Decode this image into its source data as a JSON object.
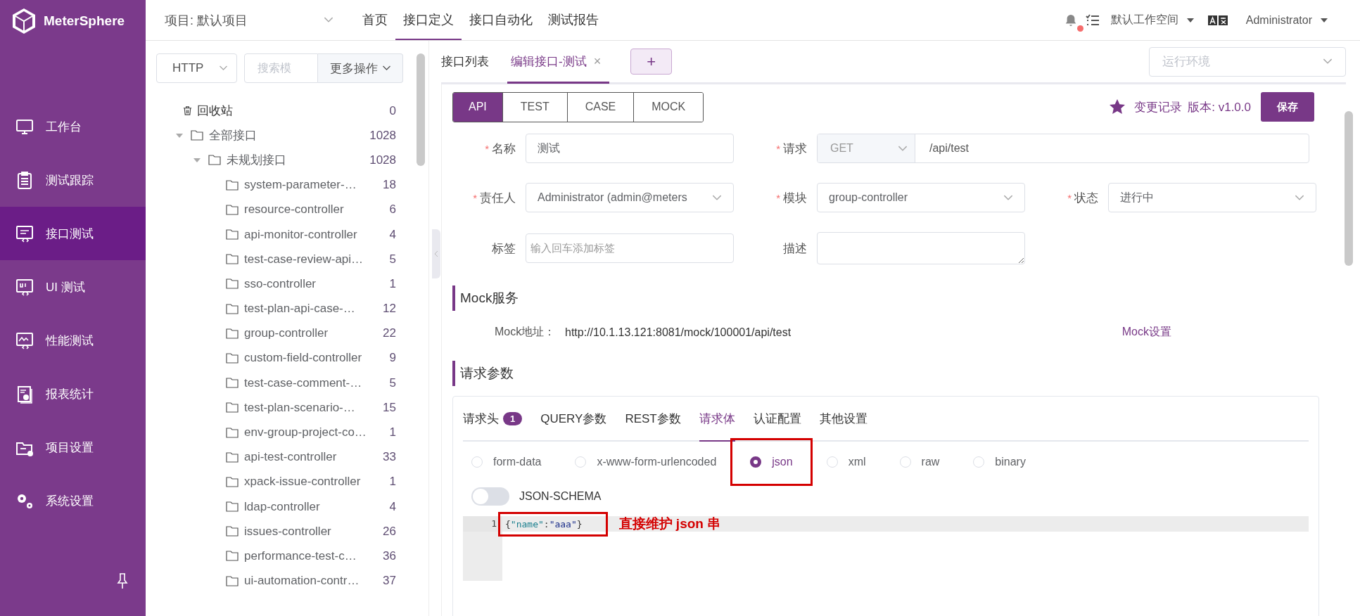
{
  "app": {
    "name": "MeterSphere"
  },
  "sidebar": {
    "items": [
      {
        "label": "工作台",
        "selected": false
      },
      {
        "label": "测试跟踪",
        "selected": false
      },
      {
        "label": "接口测试",
        "selected": true
      },
      {
        "label": "UI 测试",
        "selected": false
      },
      {
        "label": "性能测试",
        "selected": false
      },
      {
        "label": "报表统计",
        "selected": false
      },
      {
        "label": "项目设置",
        "selected": false
      },
      {
        "label": "系统设置",
        "selected": false
      }
    ]
  },
  "header": {
    "project": "项目: 默认项目",
    "nav": [
      {
        "label": "首页",
        "selected": false
      },
      {
        "label": "接口定义",
        "selected": true
      },
      {
        "label": "接口自动化",
        "selected": false
      },
      {
        "label": "测试报告",
        "selected": false
      }
    ],
    "unread": true,
    "workspace": "默认工作空间",
    "user": "Administrator"
  },
  "tree": {
    "protocol": "HTTP",
    "search": {
      "placeholder": "搜索模"
    },
    "more": "更多操作",
    "trash": {
      "label": "回收站",
      "count": "0"
    },
    "nodes": [
      {
        "label": "全部接口",
        "count": "1028",
        "expanded": true,
        "children": [
          {
            "label": "未规划接口",
            "count": "1028",
            "expanded": true,
            "children": [
              {
                "label": "system-parameter-…",
                "count": "18"
              },
              {
                "label": "resource-controller",
                "count": "6"
              },
              {
                "label": "api-monitor-controller",
                "count": "4"
              },
              {
                "label": "test-case-review-api…",
                "count": "5"
              },
              {
                "label": "sso-controller",
                "count": "1"
              },
              {
                "label": "test-plan-api-case-…",
                "count": "12"
              },
              {
                "label": "group-controller",
                "count": "22"
              },
              {
                "label": "custom-field-controller",
                "count": "9"
              },
              {
                "label": "test-case-comment-…",
                "count": "5"
              },
              {
                "label": "test-plan-scenario-…",
                "count": "15"
              },
              {
                "label": "env-group-project-co…",
                "count": "1"
              },
              {
                "label": "api-test-controller",
                "count": "33"
              },
              {
                "label": "xpack-issue-controller",
                "count": "1"
              },
              {
                "label": "ldap-controller",
                "count": "4"
              },
              {
                "label": "issues-controller",
                "count": "26"
              },
              {
                "label": "performance-test-c…",
                "count": "36"
              },
              {
                "label": "ui-automation-contr…",
                "count": "37"
              }
            ]
          }
        ]
      }
    ]
  },
  "tabs": [
    {
      "label": "接口列表",
      "selected": false
    },
    {
      "label": "编辑接口-测试",
      "selected": true,
      "close": "×"
    }
  ],
  "add_tab": "+",
  "environment": {
    "placeholder": "运行环境"
  },
  "modes": [
    {
      "label": "API",
      "selected": true
    },
    {
      "label": "TEST",
      "selected": false
    },
    {
      "label": "CASE",
      "selected": false
    },
    {
      "label": "MOCK",
      "selected": false
    }
  ],
  "version": {
    "history": "变更记录",
    "version": "版本: v1.0.0"
  },
  "save": "保存",
  "form": {
    "rows": [
      [
        {
          "kind": "text",
          "label": "名称",
          "mark": "*",
          "value": "测试"
        },
        {
          "kind": "request",
          "label": "请求",
          "mark": "*",
          "method": "GET",
          "path": "/api/test"
        }
      ],
      [
        {
          "kind": "select",
          "label": "责任人",
          "mark": "*",
          "value": "Administrator (admin@meters"
        },
        {
          "kind": "select",
          "label": "模块",
          "mark": "*",
          "value": "group-controller"
        },
        {
          "kind": "select",
          "label": "状态",
          "mark": "*",
          "value": "进行中"
        }
      ],
      [
        {
          "kind": "tags",
          "label": "标签",
          "placeholder": "输入回车添加标签"
        },
        {
          "kind": "textarea",
          "label": "描述"
        }
      ]
    ]
  },
  "mock": {
    "title": "Mock服务",
    "address_label": "Mock地址：",
    "address": "http://10.1.13.121:8081/mock/100001/api/test",
    "settings": "Mock设置"
  },
  "params": {
    "title": "请求参数",
    "tabs": [
      {
        "label": "请求头",
        "badge": "1",
        "selected": false
      },
      {
        "label": "QUERY参数",
        "selected": false
      },
      {
        "label": "REST参数",
        "selected": false
      },
      {
        "label": "请求体",
        "selected": true
      },
      {
        "label": "认证配置",
        "selected": false
      },
      {
        "label": "其他设置",
        "selected": false
      }
    ],
    "body_types": [
      {
        "label": "form-data",
        "selected": false,
        "highlighted": false
      },
      {
        "label": "x-www-form-urlencoded",
        "selected": false,
        "highlighted": false
      },
      {
        "label": "json",
        "selected": true,
        "highlighted": true
      },
      {
        "label": "xml",
        "selected": false,
        "highlighted": false
      },
      {
        "label": "raw",
        "selected": false,
        "highlighted": false
      },
      {
        "label": "binary",
        "selected": false,
        "highlighted": false
      }
    ],
    "json_schema": {
      "label": "JSON-SCHEMA",
      "on": false
    },
    "editor": {
      "lines": [
        {
          "number": "1",
          "highlighted": true,
          "tokens": [
            {
              "text": "{",
              "kind": "punct"
            },
            {
              "text": "\"name\"",
              "kind": "key"
            },
            {
              "text": ":",
              "kind": "punct"
            },
            {
              "text": "\"aaa\"",
              "kind": "string"
            },
            {
              "text": "}",
              "kind": "punct"
            }
          ]
        }
      ]
    },
    "annotation": "直接维护 json 串"
  }
}
